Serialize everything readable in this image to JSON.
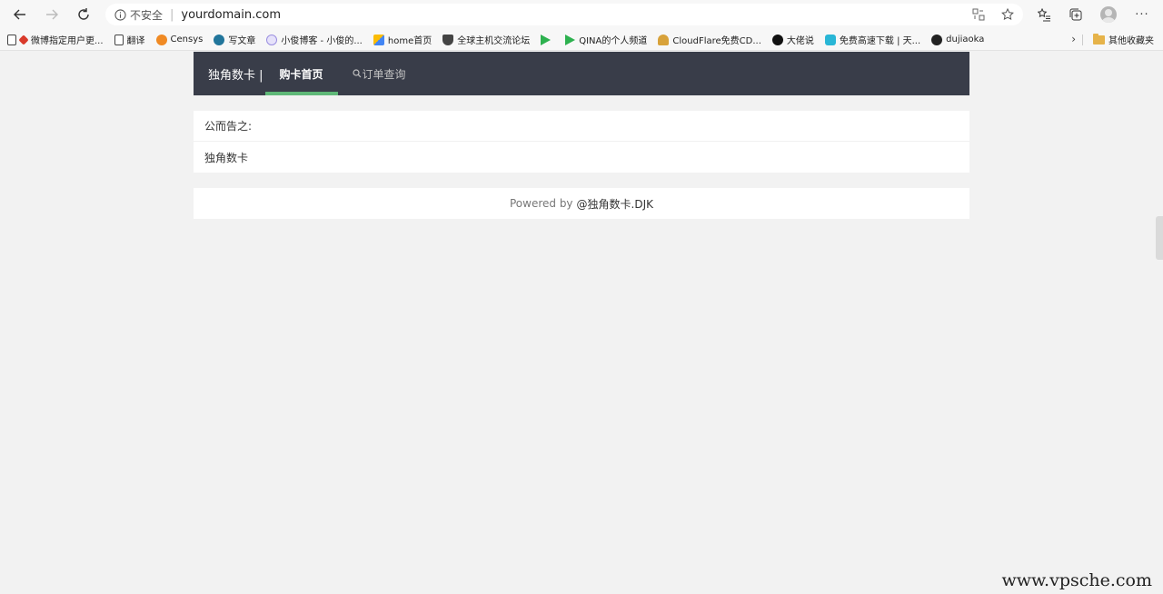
{
  "browser": {
    "security_label": "不安全",
    "url": "yourdomain.com"
  },
  "bookmarks": [
    {
      "label": "微博指定用户更...",
      "color": "#d93a2b"
    },
    {
      "label": "翻译",
      "color": "#666666"
    },
    {
      "label": "Censys",
      "color": "#f08a24"
    },
    {
      "label": "写文章",
      "color": "#21759b"
    },
    {
      "label": "小俊博客 - 小俊的...",
      "color": "#9b8fe0"
    },
    {
      "label": "home首页",
      "color": "#4285f4"
    },
    {
      "label": "全球主机交流论坛",
      "color": "#444444"
    },
    {
      "label": "",
      "color": "#2db14f"
    },
    {
      "label": "QINA的个人频道",
      "color": "#2db14f"
    },
    {
      "label": "CloudFlare免费CD...",
      "color": "#d8a23a"
    },
    {
      "label": "大佬说",
      "color": "#111111"
    },
    {
      "label": "免费高速下载 | 天...",
      "color": "#29b6d6"
    },
    {
      "label": "dujiaoka",
      "color": "#222222"
    }
  ],
  "other_bookmarks": "其他收藏夹",
  "site": {
    "brand": "独角数卡 |",
    "nav": [
      {
        "label": "购卡首页",
        "active": true
      },
      {
        "label": "订单查询",
        "active": false
      }
    ],
    "notice_title": "公而告之:",
    "notice_body": "独角数卡",
    "footer_prefix": "Powered by",
    "footer_link": "@独角数卡.DJK"
  },
  "watermark": "www.vpsche.com"
}
